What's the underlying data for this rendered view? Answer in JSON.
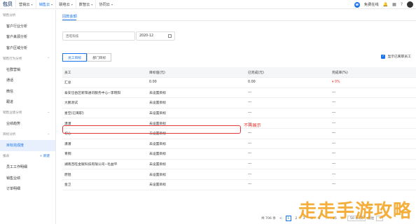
{
  "topbar": {
    "logo": "包贝",
    "tabs": [
      {
        "label": "营销云"
      },
      {
        "label": "销售云"
      },
      {
        "label": "联络云"
      },
      {
        "label": "数智云"
      },
      {
        "label": "协同云"
      }
    ],
    "status": "免费在线",
    "brand_color": "#1a73e8"
  },
  "sidebar": {
    "items": [
      {
        "label": "销售分析",
        "type": "group"
      },
      {
        "label": "客户行业分析",
        "type": "item"
      },
      {
        "label": "客户来源分析",
        "type": "item"
      },
      {
        "label": "客户区域分析",
        "type": "item"
      },
      {
        "label": "销售行为分析",
        "type": "group"
      },
      {
        "label": "社群营销",
        "type": "item"
      },
      {
        "label": "通话",
        "type": "item"
      },
      {
        "label": "微信",
        "type": "item"
      },
      {
        "label": "跟进",
        "type": "item"
      },
      {
        "label": "销售业绩分析",
        "type": "group"
      },
      {
        "label": "业绩趋势",
        "type": "item"
      },
      {
        "label": "目标分析",
        "type": "group"
      },
      {
        "label": "目标完成度",
        "type": "item",
        "active": true
      },
      {
        "label": "报表",
        "type": "group-new",
        "new": "+ 新建"
      },
      {
        "label": "员工工作明细",
        "type": "item"
      },
      {
        "label": "销售业绩",
        "type": "item"
      },
      {
        "label": "订单明细",
        "type": "item"
      }
    ]
  },
  "main": {
    "page_tab": "回款金额",
    "filter_placeholder": "百旺科技",
    "date_value": "2020-12",
    "seg_employee": "员工目标",
    "seg_department": "部门目标",
    "show_resigned": "显示已离职员工",
    "columns": [
      "员工",
      "目标值(元)",
      "已完成(元)",
      "完成率(%)"
    ],
    "rows": [
      [
        "汇总",
        "0.00",
        "0.00",
        "▾ 0%"
      ],
      [
        "泰安岱岳区新阳通讯服务中心--李晓阳",
        "未设置目标",
        "---",
        "---"
      ],
      [
        "大鹏测试",
        "未设置目标",
        "---",
        "---"
      ],
      [
        "星空(已离职)",
        "未设置目标",
        "---",
        "---"
      ],
      [
        "潇潇",
        "未设置目标",
        "---",
        "---"
      ],
      [
        "初心",
        "未设置目标",
        "---",
        "---"
      ],
      [
        "潇潇",
        "未设置目标",
        "---",
        "---"
      ],
      [
        "青铜",
        "未设置目标",
        "---",
        "---"
      ],
      [
        "湖南百旺金赋科技有限公司--毛益平",
        "未设置目标",
        "---",
        "---"
      ],
      [
        "原锟",
        "未设置目标",
        "---",
        "---"
      ],
      [
        "金卫",
        "未设置目标",
        "---",
        "---"
      ]
    ],
    "annotation": "不再展示",
    "pagination": {
      "total": "共 706 条",
      "prev": "<",
      "pages": [
        "1",
        "2",
        "3",
        "4",
        "5",
        "...",
        "15"
      ],
      "next": ">",
      "page_size": "50 条/页",
      "goto": "前往"
    }
  },
  "watermark": "走走手游攻略"
}
